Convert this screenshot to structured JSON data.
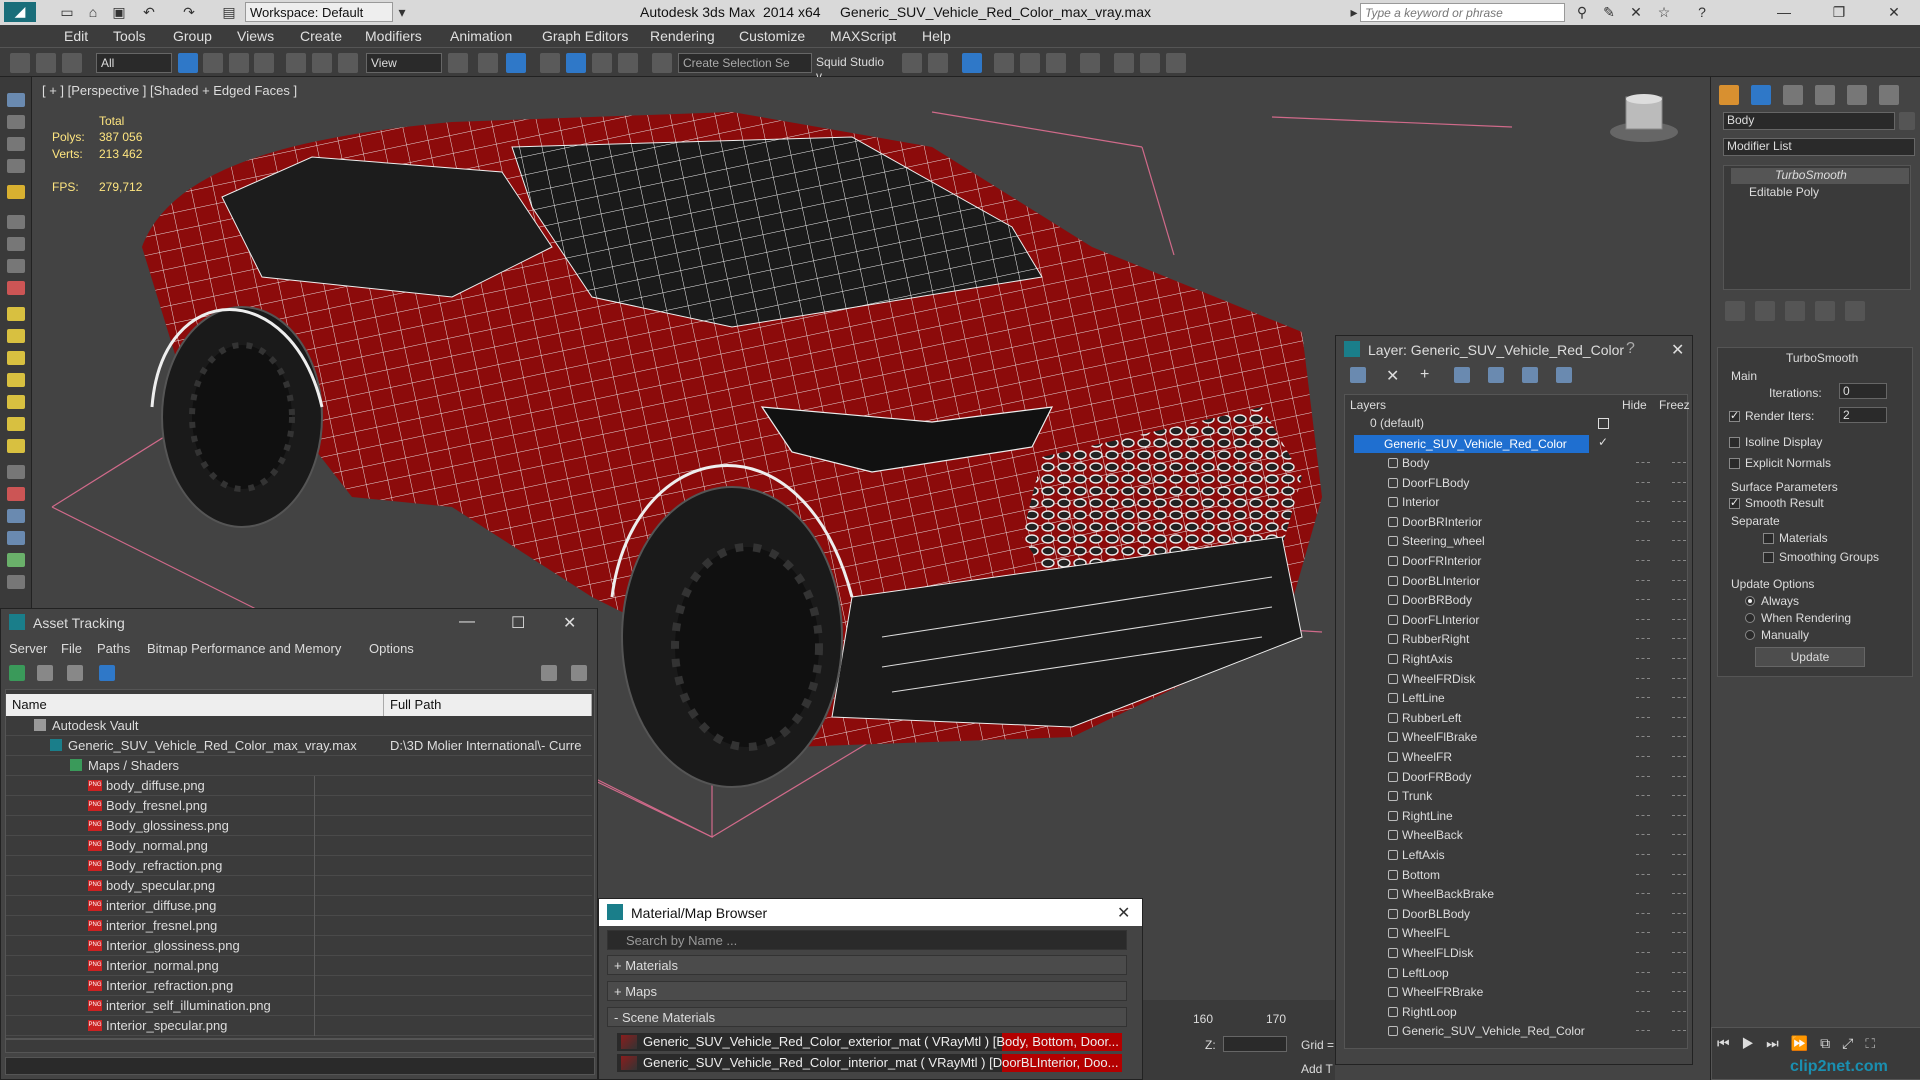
{
  "titlebar": {
    "title": "Autodesk 3ds Max  2014 x64     Generic_SUV_Vehicle_Red_Color_max_vray.max",
    "workspace": "Workspace: Default",
    "search_placeholder": "Type a keyword or phrase"
  },
  "menu": [
    "Edit",
    "Tools",
    "Group",
    "Views",
    "Create",
    "Modifiers",
    "Animation",
    "Graph Editors",
    "Rendering",
    "Customize",
    "MAXScript",
    "Help"
  ],
  "toolbar": {
    "selection_filter": "All",
    "ref_coord": "View",
    "selection_set_placeholder": "Create Selection Se",
    "squid": "Squid Studio v"
  },
  "viewport": {
    "label": "[ + ] [Perspective ] [Shaded + Edged Faces ]",
    "stats": {
      "total_label": "Total",
      "polys_label": "Polys:",
      "polys_value": "387 056",
      "verts_label": "Verts:",
      "verts_value": "213 462",
      "fps_label": "FPS:",
      "fps_value": "279,712"
    }
  },
  "command_panel": {
    "object_name": "Body",
    "modifier_list": "Modifier List",
    "stack": [
      "TurboSmooth",
      "Editable Poly"
    ],
    "turbosmooth": {
      "title": "TurboSmooth",
      "main": "Main",
      "iterations_label": "Iterations:",
      "iterations_value": "0",
      "render_iters_label": "Render Iters:",
      "render_iters_value": "2",
      "render_iters_checked": true,
      "isoline": "Isoline Display",
      "explicit_normals": "Explicit Normals",
      "surface_params": "Surface Parameters",
      "smooth_result": "Smooth Result",
      "separate": "Separate",
      "materials": "Materials",
      "smoothing_groups": "Smoothing Groups",
      "update_options": "Update Options",
      "always": "Always",
      "when_rendering": "When Rendering",
      "manually": "Manually",
      "update_button": "Update"
    }
  },
  "asset_tracking": {
    "title": "Asset Tracking",
    "menu": [
      "Server",
      "File",
      "Paths",
      "Bitmap Performance and Memory",
      "Options"
    ],
    "columns": {
      "name": "Name",
      "full_path": "Full Path"
    },
    "vault": "Autodesk Vault",
    "file": {
      "name": "Generic_SUV_Vehicle_Red_Color_max_vray.max",
      "path": "D:\\3D Molier International\\- Curre"
    },
    "maps_group": "Maps / Shaders",
    "maps": [
      "body_diffuse.png",
      "Body_fresnel.png",
      "Body_glossiness.png",
      "Body_normal.png",
      "Body_refraction.png",
      "body_specular.png",
      "interior_diffuse.png",
      "interior_fresnel.png",
      "Interior_glossiness.png",
      "Interior_normal.png",
      "Interior_refraction.png",
      "interior_self_illumination.png",
      "Interior_specular.png"
    ]
  },
  "layer_explorer": {
    "title": "Layer: Generic_SUV_Vehicle_Red_Color",
    "col_layers": "Layers",
    "col_hide": "Hide",
    "col_freeze": "Freez",
    "default_layer": "0 (default)",
    "active_layer": "Generic_SUV_Vehicle_Red_Color",
    "objects": [
      "Body",
      "DoorFLBody",
      "Interior",
      "DoorBRInterior",
      "Steering_wheel",
      "DoorFRInterior",
      "DoorBLInterior",
      "DoorBRBody",
      "DoorFLInterior",
      "RubberRight",
      "RightAxis",
      "WheelFRDisk",
      "LeftLine",
      "RubberLeft",
      "WheelFlBrake",
      "WheelFR",
      "DoorFRBody",
      "Trunk",
      "RightLine",
      "WheelBack",
      "LeftAxis",
      "Bottom",
      "WheelBackBrake",
      "DoorBLBody",
      "WheelFL",
      "WheelFLDisk",
      "LeftLoop",
      "WheelFRBrake",
      "RightLoop",
      "Generic_SUV_Vehicle_Red_Color"
    ]
  },
  "material_browser": {
    "title": "Material/Map Browser",
    "search_placeholder": "Search by Name ...",
    "sections": [
      "+ Materials",
      "+ Maps",
      "- Scene Materials"
    ],
    "items": [
      "Generic_SUV_Vehicle_Red_Color_exterior_mat ( VRayMtl ) [Body, Bottom, Door...",
      "Generic_SUV_Vehicle_Red_Color_interior_mat ( VRayMtl ) [DoorBLInterior, Doo..."
    ]
  },
  "timeline": {
    "ticks": [
      "160",
      "170"
    ],
    "z_label": "Z:",
    "grid_label": "Grid =",
    "add_label": "Add T"
  },
  "watermark": "clip2net.com",
  "colors": {
    "accent": "#1f6fd0",
    "car_red": "#8c0b0b",
    "bg": "#434343",
    "helper_pink": "#d06a8a"
  }
}
